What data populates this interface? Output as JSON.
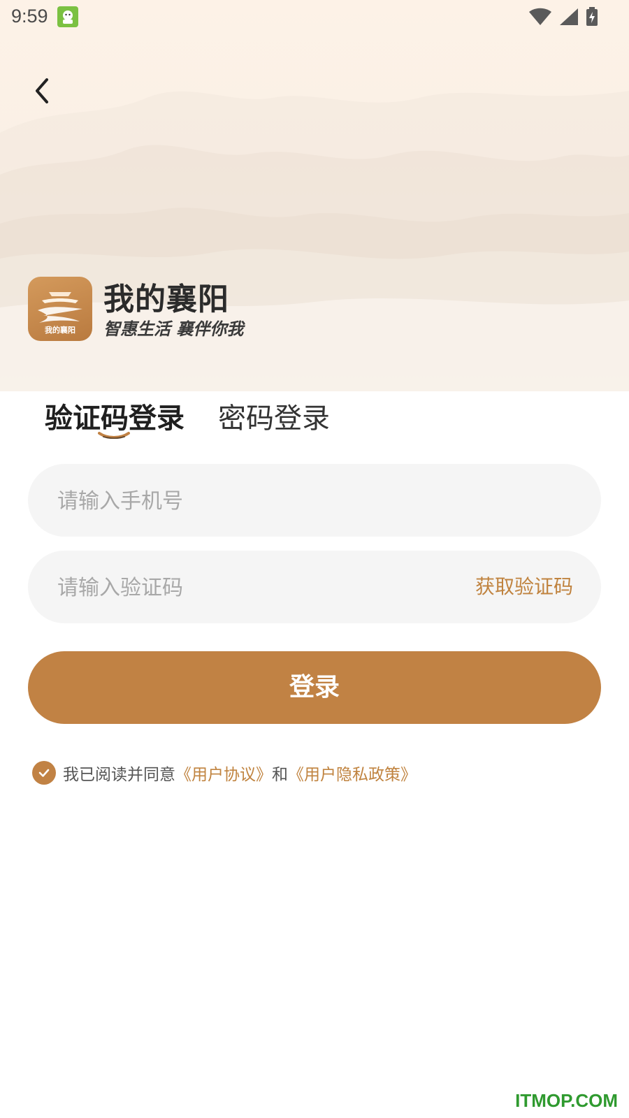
{
  "status_bar": {
    "time": "9:59",
    "icons": [
      "app-notification-icon",
      "wifi-icon",
      "signal-icon",
      "battery-charging-icon"
    ]
  },
  "nav": {
    "back_icon": "chevron-left-icon"
  },
  "brand": {
    "name": "我的襄阳",
    "slogan": "智惠生活 襄伴你我",
    "icon_text": "我的襄阳"
  },
  "tabs": [
    {
      "label": "验证码登录",
      "active": true
    },
    {
      "label": "密码登录",
      "active": false
    }
  ],
  "form": {
    "phone_placeholder": "请输入手机号",
    "code_placeholder": "请输入验证码",
    "get_code_label": "获取验证码",
    "login_label": "登录"
  },
  "agreement": {
    "checked": true,
    "prefix": "我已阅读并同意",
    "user_agreement": "《用户协议》",
    "and": "和",
    "privacy_policy": "《用户隐私政策》"
  },
  "watermark": "ITMOP.COM",
  "colors": {
    "accent": "#c18244",
    "link": "#c0833f",
    "input_bg": "#f5f5f5"
  }
}
